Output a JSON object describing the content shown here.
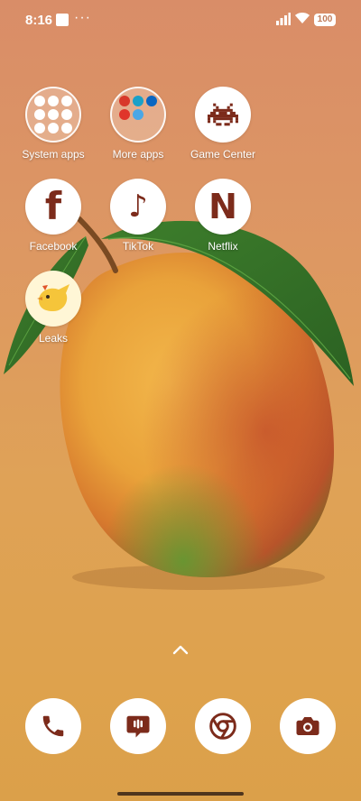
{
  "status_bar": {
    "time": "8:16",
    "more": "···",
    "battery": "100",
    "icons": [
      "square-notification-icon",
      "signal-icon",
      "wifi-icon",
      "battery-icon"
    ]
  },
  "home": {
    "row1": [
      {
        "label": "System apps",
        "icon": "folder-icon"
      },
      {
        "label": "More apps",
        "icon": "folder-icon"
      },
      {
        "label": "Game Center",
        "icon": "space-invader-icon"
      }
    ],
    "row2": [
      {
        "label": "Facebook",
        "icon": "facebook-icon",
        "glyph": "f"
      },
      {
        "label": "TikTok",
        "icon": "music-note-icon",
        "glyph": "♪"
      },
      {
        "label": "Netflix",
        "icon": "netflix-icon",
        "glyph": "N"
      }
    ],
    "row3": [
      {
        "label": "Leaks",
        "icon": "bird-icon"
      }
    ]
  },
  "dock": [
    "phone-icon",
    "messages-icon",
    "chrome-icon",
    "camera-icon"
  ],
  "colors": {
    "icon_glyph": "#7c2b1b",
    "wallpaper_top": "#d98d68",
    "wallpaper_bottom": "#dba04a"
  }
}
